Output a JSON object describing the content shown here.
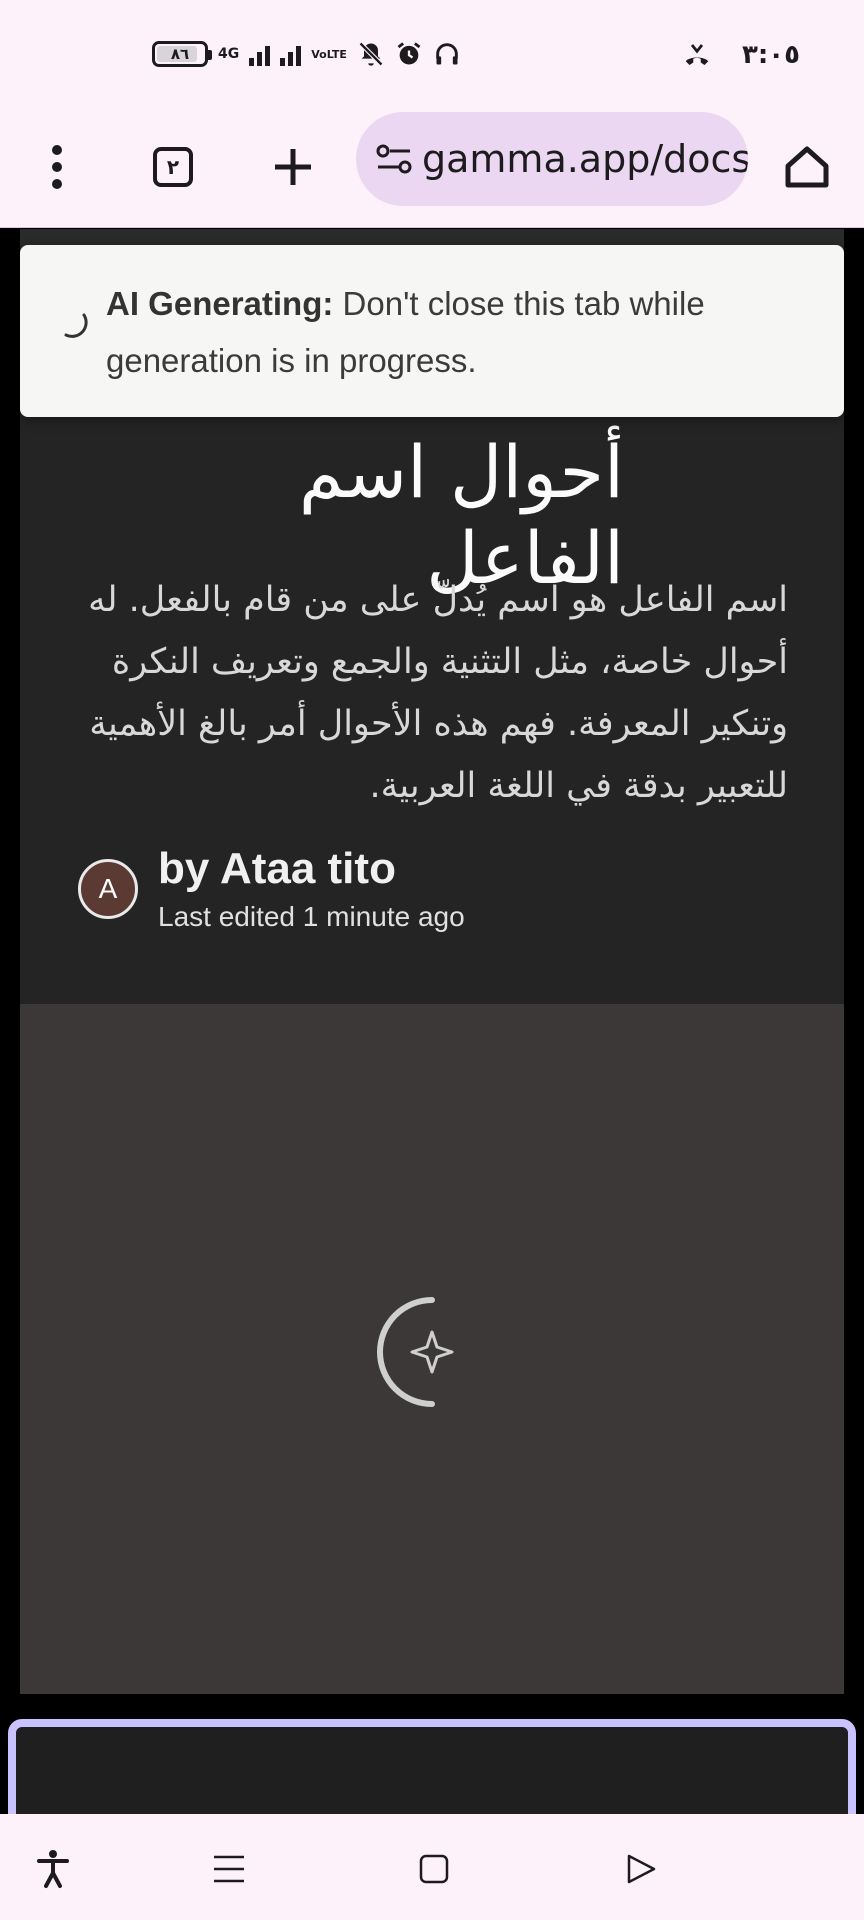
{
  "status_bar": {
    "battery": "٨٦",
    "network": "4G",
    "volte": "VoLTE",
    "time": "٣:٠٥"
  },
  "browser": {
    "tab_count": "٢",
    "url": "gamma.app/docs"
  },
  "toast": {
    "icon": "spinner-icon",
    "bold": "AI Generating:",
    "message": "Don't close this tab while generation is in progress."
  },
  "doc": {
    "title": "أحوال اسم الفاعل",
    "description": "اسم الفاعل هو اسم يُدلّ على من قام بالفعل. له أحوال خاصة، مثل التثنية والجمع وتعريف النكرة وتنكير المعرفة. فهم هذه الأحوال أمر بالغ الأهمية للتعبير بدقة في اللغة العربية.",
    "avatar_letter": "A",
    "author": "by Ataa tito",
    "edited": "Last edited 1 minute ago"
  },
  "colors": {
    "chrome_bg": "#fdf1fa",
    "url_bg": "#ecd7f2",
    "card_bg": "#242424",
    "image_placeholder": "#3c3838",
    "next_card_border": "#c8c3ff"
  }
}
